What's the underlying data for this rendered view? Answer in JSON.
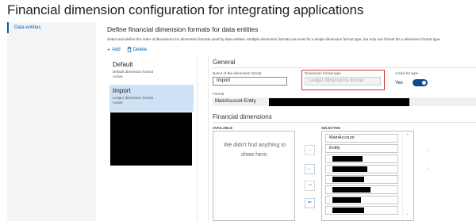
{
  "page": {
    "title": "Financial dimension configuration for integrating applications"
  },
  "left_nav": {
    "items": [
      {
        "label": "Data entities"
      }
    ]
  },
  "section": {
    "title": "Define financial dimension formats for data entities",
    "description": "Select and define the order of dimensions for dimension formats used by data entities. Multiple dimension formats can exist for a single dimension format type, but only one format for a dimension format type"
  },
  "toolbar": {
    "add_label": "Add",
    "delete_label": "Delete"
  },
  "formats": [
    {
      "name": "Default",
      "desc": "Default dimension format",
      "status": "Active",
      "selected": false
    },
    {
      "name": "Import",
      "desc": "Ledger dimension format",
      "status": "Active",
      "selected": true
    }
  ],
  "general": {
    "heading": "General",
    "name_label": "Name of the dimension format",
    "name_value": "Import",
    "type_label": "Dimension format type",
    "type_value": "Ledger dimensions format",
    "active_label": "Active for type",
    "active_value": "Yes",
    "format_label": "Format",
    "format_value": "MainAccount-Entity"
  },
  "financial_dimensions": {
    "heading": "Financial dimensions",
    "available_label": "AVAILABLE",
    "selected_label": "SELECTED",
    "empty_message": "We didn't find anything to show here.",
    "selected_items": [
      "MainAccount",
      "Entity"
    ]
  },
  "icons": {
    "add": "plus-icon",
    "delete": "trash-icon",
    "move_right": "arrow-right-icon",
    "move_left": "arrow-left-icon",
    "move_all_left": "double-arrow-left-icon",
    "move_all_right": "double-arrow-right-icon",
    "move_up": "arrow-up-icon",
    "move_down": "arrow-down-icon"
  },
  "colors": {
    "accent": "#0063b1",
    "selected_bg": "#cfe1f4",
    "highlight_border": "#d23a3a",
    "toggle_on": "#0a4b8a"
  }
}
